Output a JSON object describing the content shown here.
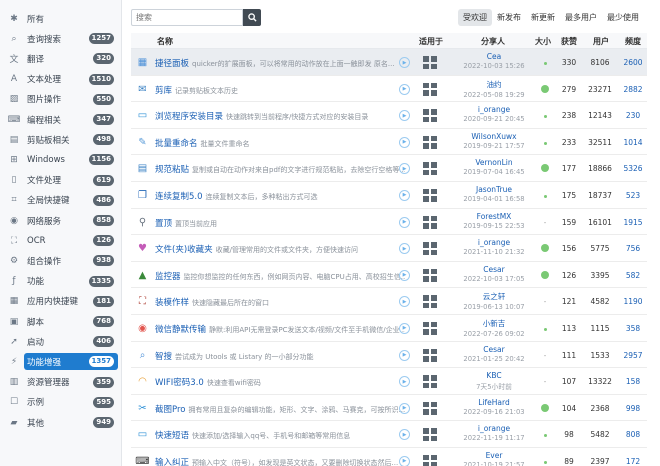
{
  "sidebar": {
    "items": [
      {
        "label": "所有",
        "icon": "asterisk-icon",
        "glyph": "✱",
        "badge": ""
      },
      {
        "label": "查询搜索",
        "icon": "search-icon",
        "glyph": "⌕",
        "badge": "1257"
      },
      {
        "label": "翻译",
        "icon": "translate-icon",
        "glyph": "文",
        "badge": "320"
      },
      {
        "label": "文本处理",
        "icon": "text-icon",
        "glyph": "A",
        "badge": "1510"
      },
      {
        "label": "图片操作",
        "icon": "image-icon",
        "glyph": "▨",
        "badge": "550"
      },
      {
        "label": "编程相关",
        "icon": "code-icon",
        "glyph": "⌨",
        "badge": "347"
      },
      {
        "label": "剪贴板相关",
        "icon": "clipboard-icon",
        "glyph": "▤",
        "badge": "498"
      },
      {
        "label": "Windows",
        "icon": "windows-icon",
        "glyph": "⊞",
        "badge": "1156"
      },
      {
        "label": "文件处理",
        "icon": "file-icon",
        "glyph": "▯",
        "badge": "619"
      },
      {
        "label": "全局快捷键",
        "icon": "keyboard-icon",
        "glyph": "⌗",
        "badge": "486"
      },
      {
        "label": "网络服务",
        "icon": "network-icon",
        "glyph": "◉",
        "badge": "858"
      },
      {
        "label": "OCR",
        "icon": "ocr-icon",
        "glyph": "⛶",
        "badge": "126"
      },
      {
        "label": "组合操作",
        "icon": "combo-icon",
        "glyph": "⚙",
        "badge": "938"
      },
      {
        "label": "功能",
        "icon": "function-icon",
        "glyph": "ƒ",
        "badge": "1335"
      },
      {
        "label": "应用内快捷键",
        "icon": "app-hotkey-icon",
        "glyph": "▦",
        "badge": "181"
      },
      {
        "label": "脚本",
        "icon": "script-icon",
        "glyph": "▣",
        "badge": "768"
      },
      {
        "label": "启动",
        "icon": "launch-icon",
        "glyph": "➚",
        "badge": "406"
      },
      {
        "label": "功能增强",
        "icon": "enhance-icon",
        "glyph": "⚡",
        "badge": "1357",
        "active": true
      },
      {
        "label": "资源管理器",
        "icon": "explorer-icon",
        "glyph": "▥",
        "badge": "359"
      },
      {
        "label": "示例",
        "icon": "example-icon",
        "glyph": "☐",
        "badge": "595"
      },
      {
        "label": "其他",
        "icon": "other-icon",
        "glyph": "▰",
        "badge": "949"
      }
    ]
  },
  "search": {
    "placeholder": "搜索"
  },
  "sort_tabs": [
    {
      "label": "受欢迎",
      "active": true
    },
    {
      "label": "新发布"
    },
    {
      "label": "新更新"
    },
    {
      "label": "最多用户"
    },
    {
      "label": "最少使用"
    }
  ],
  "table": {
    "headers": {
      "name": "名称",
      "for": "适用于",
      "author": "分享人",
      "size": "大小",
      "likes": "获赞",
      "users": "用户",
      "freq": "频度"
    },
    "rows": [
      {
        "name": "捷径面板",
        "desc": "quicker的扩展面板，可以将常用的动作放在上面一触即发 原名...",
        "author": "Cea",
        "date": "2022-10-03 15:26",
        "size": "small",
        "likes": "330",
        "users": "8106",
        "freq": "2600",
        "icon_color": "#4a8fd8",
        "glyph": "▦",
        "hl": true
      },
      {
        "name": "剪库",
        "desc": "记录剪贴板文本历史",
        "author": "油约",
        "date": "2022-05-08 19:29",
        "size": "big",
        "likes": "279",
        "users": "23271",
        "freq": "2882",
        "icon_color": "#3b82c4",
        "glyph": "✉"
      },
      {
        "name": "浏览程序安装目录",
        "desc": "快速跳转到当前程序/快捷方式对应的安装目录",
        "author": "i_orange",
        "date": "2020-09-21 20:45",
        "size": "small",
        "likes": "238",
        "users": "12143",
        "freq": "230",
        "icon_color": "#2b8fd6",
        "glyph": "▭"
      },
      {
        "name": "批量重命名",
        "desc": "批量文件重命名",
        "author": "WilsonXuwx",
        "date": "2019-09-21 17:57",
        "size": "small",
        "likes": "233",
        "users": "32511",
        "freq": "1014",
        "icon_color": "#5a9bd8",
        "glyph": "✎"
      },
      {
        "name": "规范粘贴",
        "desc": "复制或自动在动作对来自pdf的文字进行规范粘贴，去除空行空格等...",
        "author": "VernonLin",
        "date": "2019-07-04 16:45",
        "size": "big",
        "likes": "177",
        "users": "18866",
        "freq": "5326",
        "icon_color": "#3b82c4",
        "glyph": "▤"
      },
      {
        "name": "连续复制5.0",
        "desc": "连续复制文本后，多种粘出方式可选",
        "author": "JasonTrue",
        "date": "2019-04-01 16:58",
        "size": "small",
        "likes": "175",
        "users": "18737",
        "freq": "523",
        "icon_color": "#2468b8",
        "glyph": "❐"
      },
      {
        "name": "置顶",
        "desc": "置顶当前应用",
        "author": "ForestMX",
        "date": "2019-09-15 22:53",
        "size": "dash",
        "likes": "159",
        "users": "16101",
        "freq": "1915",
        "icon_color": "#6a7480",
        "glyph": "⚲"
      },
      {
        "name": "文件(夹)收藏夹",
        "desc": "收藏/管理常用的文件或文件夹，方便快速访问",
        "author": "i_orange",
        "date": "2021-11-10 21:32",
        "size": "big",
        "likes": "156",
        "users": "5775",
        "freq": "756",
        "icon_color": "#c45cb8",
        "glyph": "♥"
      },
      {
        "name": "监控器",
        "desc": "监控你想监控的任何东西，例如网页内容、电脑CPU占用、高校招生信...",
        "author": "Cesar",
        "date": "2022-10-03 17:05",
        "size": "big",
        "likes": "126",
        "users": "3395",
        "freq": "582",
        "icon_color": "#3a8a3a",
        "glyph": "▲"
      },
      {
        "name": "装模作样",
        "desc": "快速隐藏最后所在的窗口",
        "author": "云之轩",
        "date": "2019-06-13 10:07",
        "size": "dash",
        "likes": "121",
        "users": "4582",
        "freq": "1190",
        "icon_color": "#b0443a",
        "glyph": "⛶"
      },
      {
        "name": "微信静默传输",
        "desc": "静默:利用API无需登录PC发送文本/视频/文件至手机微信/企业...",
        "author": "小新吉",
        "date": "2022-07-26 09:02",
        "size": "small",
        "likes": "113",
        "users": "1115",
        "freq": "358",
        "icon_color": "#e2554e",
        "glyph": "◉"
      },
      {
        "name": "智搜",
        "desc": "尝试成为 Utools 或 Listary 的一小部分功能",
        "author": "Cesar",
        "date": "2021-01-25 20:42",
        "size": "dash",
        "likes": "111",
        "users": "1533",
        "freq": "2957",
        "icon_color": "#4a8fd8",
        "glyph": "⌕"
      },
      {
        "name": "WIFI密码3.0",
        "desc": "快速查看wifi密码",
        "author": "KBC",
        "date": "7天5小时前",
        "size": "dash",
        "likes": "107",
        "users": "13322",
        "freq": "158",
        "icon_color": "#e8a23a",
        "glyph": "◠"
      },
      {
        "name": "截图Pro",
        "desc": "拥有常用且复杂的编辑功能，矩形、文字、涂鸦、马赛克，可按所识...",
        "author": "LifeHard",
        "date": "2022-09-16 21:03",
        "size": "big",
        "likes": "104",
        "users": "2368",
        "freq": "998",
        "icon_color": "#2b8fd6",
        "glyph": "✂"
      },
      {
        "name": "快速短语",
        "desc": "快速添加/选择输入qq号、手机号和邮箱等常用信息",
        "author": "i_orange",
        "date": "2022-11-19 11:17",
        "size": "small",
        "likes": "98",
        "users": "5482",
        "freq": "808",
        "icon_color": "#2b8fd6",
        "glyph": "▭"
      },
      {
        "name": "输入纠正",
        "desc": "预输入中文（符号），如发现是英文状态，又要删除切换状态然后...",
        "author": "Ever",
        "date": "2021-10-19 21:57",
        "size": "small",
        "likes": "89",
        "users": "2397",
        "freq": "172",
        "icon_color": "#333333",
        "glyph": "⌨"
      }
    ]
  }
}
